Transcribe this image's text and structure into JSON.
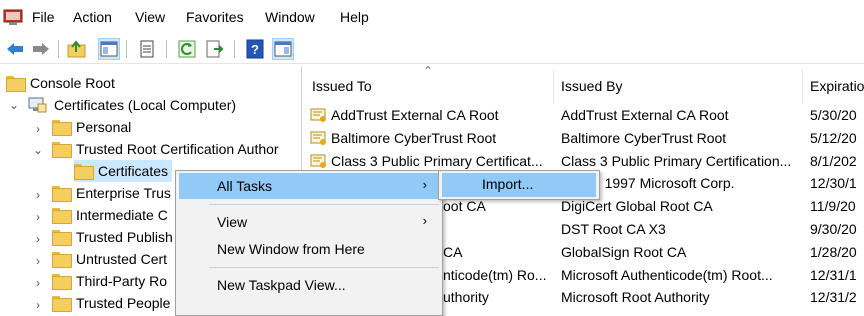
{
  "menubar": {
    "items": [
      "File",
      "Action",
      "View",
      "Favorites",
      "Window",
      "Help"
    ]
  },
  "toolbar": {
    "icons": [
      "back-icon",
      "forward-icon",
      "up-folder-icon",
      "show-hide-tree-icon",
      "properties-icon",
      "refresh-icon",
      "export-list-icon",
      "help-icon",
      "action-pane-icon"
    ]
  },
  "tree": {
    "root": "Console Root",
    "computer": "Certificates (Local Computer)",
    "personal": "Personal",
    "trusted_root": "Trusted Root Certification Author",
    "certificates": "Certificates",
    "enterprise": "Enterprise Trus",
    "intermediate": "Intermediate C",
    "trusted_publishers": "Trusted Publish",
    "untrusted": "Untrusted Cert",
    "third_party": "Third-Party Ro",
    "trusted_people": "Trusted People"
  },
  "list": {
    "columns": [
      "Issued To",
      "Issued By",
      "Expiratio"
    ],
    "rows": [
      {
        "issued_to": "AddTrust External CA Root",
        "issued_by": "AddTrust External CA Root",
        "expiration": "5/30/20"
      },
      {
        "issued_to": "Baltimore CyberTrust Root",
        "issued_by": "Baltimore CyberTrust Root",
        "expiration": "5/12/20"
      },
      {
        "issued_to": "Class 3 Public Primary Certificat...",
        "issued_by": "Class 3 Public Primary Certification...",
        "expiration": "8/1/202"
      },
      {
        "issued_to": "",
        "issued_by": "ght (c) 1997 Microsoft Corp.",
        "expiration": "12/30/1"
      },
      {
        "issued_to": "oot CA",
        "issued_by": "DigiCert Global Root CA",
        "expiration": "11/9/20"
      },
      {
        "issued_to": "",
        "issued_by": "DST Root CA X3",
        "expiration": "9/30/20"
      },
      {
        "issued_to": "CA",
        "issued_by": "GlobalSign Root CA",
        "expiration": "1/28/20"
      },
      {
        "issued_to": "nticode(tm) Ro...",
        "issued_by": "Microsoft Authenticode(tm) Root...",
        "expiration": "12/31/1"
      },
      {
        "issued_to": "uthority",
        "issued_by": "Microsoft Root Authority",
        "expiration": "12/31/2"
      }
    ]
  },
  "context_menu": {
    "all_tasks": "All Tasks",
    "view": "View",
    "new_window": "New Window from Here",
    "new_taskpad": "New Taskpad View...",
    "submenu_arrow": "›"
  },
  "submenu": {
    "import": "Import..."
  },
  "colors": {
    "highlight": "#91c9f7",
    "selection": "#cce8ff",
    "menu_bg": "#f2f2f2"
  }
}
